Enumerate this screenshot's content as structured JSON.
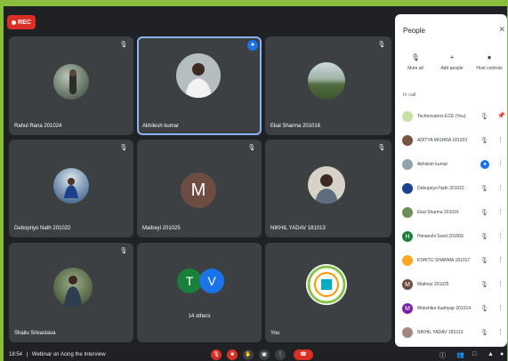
{
  "recording": {
    "label": "REC"
  },
  "tiles": [
    {
      "name": "Rahul Rana 201024"
    },
    {
      "name": "Akhilesh kumar"
    },
    {
      "name": "Ekal Sharma 201016"
    },
    {
      "name": "Debopriyo Nath 201022"
    },
    {
      "name": "Maitreyi 201025",
      "initial": "M"
    },
    {
      "name": "NIKHIL YADAV 181013"
    },
    {
      "name": "Shailu Srivastava"
    },
    {
      "name": "14 others",
      "initials": [
        "T",
        "V"
      ]
    },
    {
      "name": "You"
    }
  ],
  "people_panel": {
    "title": "People",
    "actions": [
      {
        "label": "Mute all"
      },
      {
        "label": "Add people"
      },
      {
        "label": "Host controls"
      }
    ],
    "section_label": "In call",
    "participants": [
      {
        "name": "Technovators ECE (You)"
      },
      {
        "name": "ADITYA MISHRA 181023"
      },
      {
        "name": "Akhilesh kumar"
      },
      {
        "name": "Debopriyo Nath 201022"
      },
      {
        "name": "Ekal Sharma 201016"
      },
      {
        "name": "Himanshi Sood 201006",
        "initial": "H"
      },
      {
        "name": "KSHITIJ SHARMA 181017"
      },
      {
        "name": "Maitreyi 201025",
        "initial": "M"
      },
      {
        "name": "Mokshika Kashyap 201014",
        "initial": "M"
      },
      {
        "name": "NIKHIL YADAV 181013"
      }
    ]
  },
  "bottom_bar": {
    "time": "18:54",
    "separator": "|",
    "meeting_title": "Webinar on Acing the Interview"
  },
  "colors": {
    "border": "#8bbd3c",
    "background": "#202124",
    "tile": "#3c4043",
    "rec": "#d93025",
    "accent": "#1a73e8",
    "maitreyi": "#6d4c41",
    "tile_t": "#188038",
    "tile_v": "#1a73e8",
    "himanshi": "#188038",
    "mokshika": "#7b1fa2"
  }
}
